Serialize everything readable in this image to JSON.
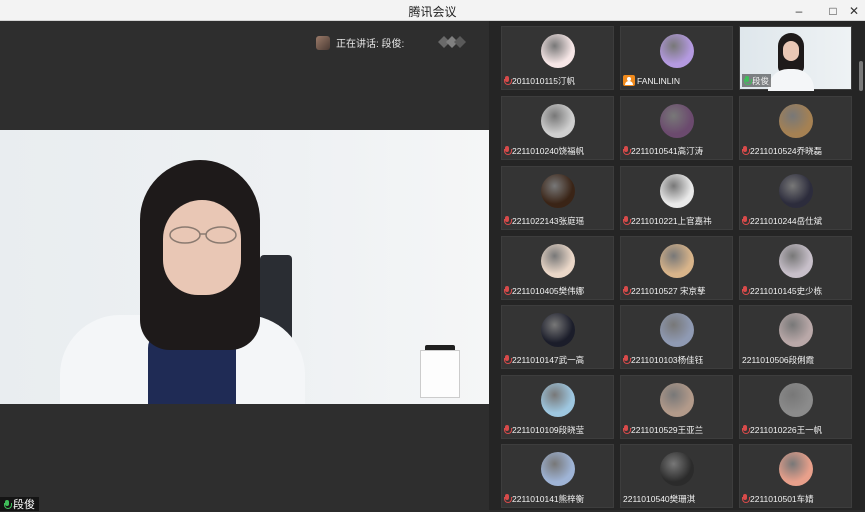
{
  "window": {
    "title": "腾讯会议"
  },
  "speaking": {
    "text": "正在讲话: 段俊:"
  },
  "main_video": {
    "name": "段俊"
  },
  "participants": [
    {
      "name": "2011010115汀帆",
      "mic": "red",
      "avatar": "#f6e6e6"
    },
    {
      "name": "FANLINLIN",
      "mic": "orange",
      "avatar": "#b49ae0"
    },
    {
      "name": "段俊",
      "mic": "green",
      "avatar": "video"
    },
    {
      "name": "2211010240饶福帆",
      "mic": "red",
      "avatar": "#cfcfcf"
    },
    {
      "name": "2211010541高汀涛",
      "mic": "red",
      "avatar": "#6b4a6e"
    },
    {
      "name": "2211010524乔晓磊",
      "mic": "red",
      "avatar": "#a58153"
    },
    {
      "name": "2211022143张庭瑶",
      "mic": "red",
      "avatar": "#3a2416"
    },
    {
      "name": "2211010221上官嘉祎",
      "mic": "red",
      "avatar": "#e9e9e9"
    },
    {
      "name": "2211010244岳仕斌",
      "mic": "red",
      "avatar": "#2c2c3c"
    },
    {
      "name": "2211010405樊伟娜",
      "mic": "red",
      "avatar": "#ead7c8"
    },
    {
      "name": "2211010527 宋京孳",
      "mic": "red",
      "avatar": "#d8b48a"
    },
    {
      "name": "2211010145史少栋",
      "mic": "red",
      "avatar": "#c7bfc9"
    },
    {
      "name": "2211010147武一高",
      "mic": "red",
      "avatar": "#1b1d2a"
    },
    {
      "name": "2211010103杨佳钰",
      "mic": "red",
      "avatar": "#8f9ab3"
    },
    {
      "name": "2211010506段俐霞",
      "mic": "none",
      "avatar": "#b9a8a8"
    },
    {
      "name": "2211010109段晓莹",
      "mic": "red",
      "avatar": "#9ec7e0"
    },
    {
      "name": "2211010529王亚兰",
      "mic": "red",
      "avatar": "#b29a8a"
    },
    {
      "name": "2211010226王一帆",
      "mic": "red",
      "avatar": "#8b8b8b"
    },
    {
      "name": "2211010141熊梓衡",
      "mic": "red",
      "avatar": "#9fb4d6"
    },
    {
      "name": "2211010540樊珊淇",
      "mic": "none",
      "avatar": "#2b2b2b"
    },
    {
      "name": "2211010501车婧",
      "mic": "red",
      "avatar": "#e8a08b"
    }
  ]
}
